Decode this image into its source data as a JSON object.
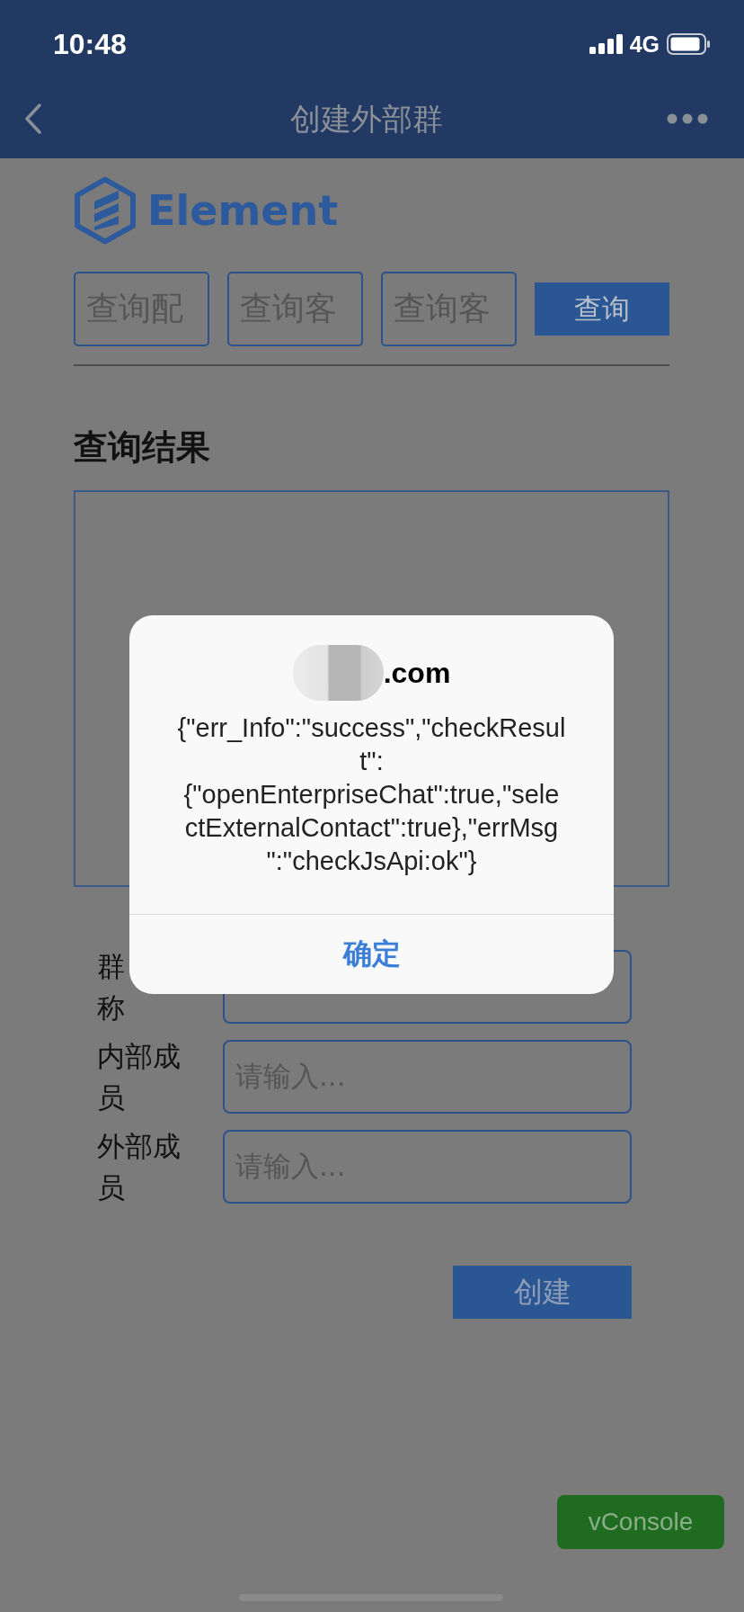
{
  "status_bar": {
    "time": "10:48",
    "network": "4G"
  },
  "nav_bar": {
    "title": "创建外部群"
  },
  "logo": {
    "text": "Element"
  },
  "query": {
    "fields": [
      {
        "placeholder": "查询配"
      },
      {
        "placeholder": "查询客"
      },
      {
        "placeholder": "查询客"
      }
    ],
    "button": "查询"
  },
  "results": {
    "heading": "查询结果"
  },
  "form": {
    "rows": [
      {
        "label_lines": [
          "群",
          "称"
        ]
      },
      {
        "label_lines": [
          "内部成",
          "员"
        ],
        "placeholder": "请输入..."
      },
      {
        "label_lines": [
          "外部成",
          "员"
        ],
        "placeholder": "请输入..."
      }
    ],
    "submit": "创建"
  },
  "dialog": {
    "title": ".com",
    "message_lines": [
      "{\"err_Info\":\"success\",\"checkResul",
      "t\":",
      "{\"openEnterpriseChat\":true,\"sele",
      "ctExternalContact\":true},\"errMsg",
      "\":\"checkJsApi:ok\"}"
    ],
    "confirm": "确定"
  },
  "vconsole": {
    "label": "vConsole"
  }
}
